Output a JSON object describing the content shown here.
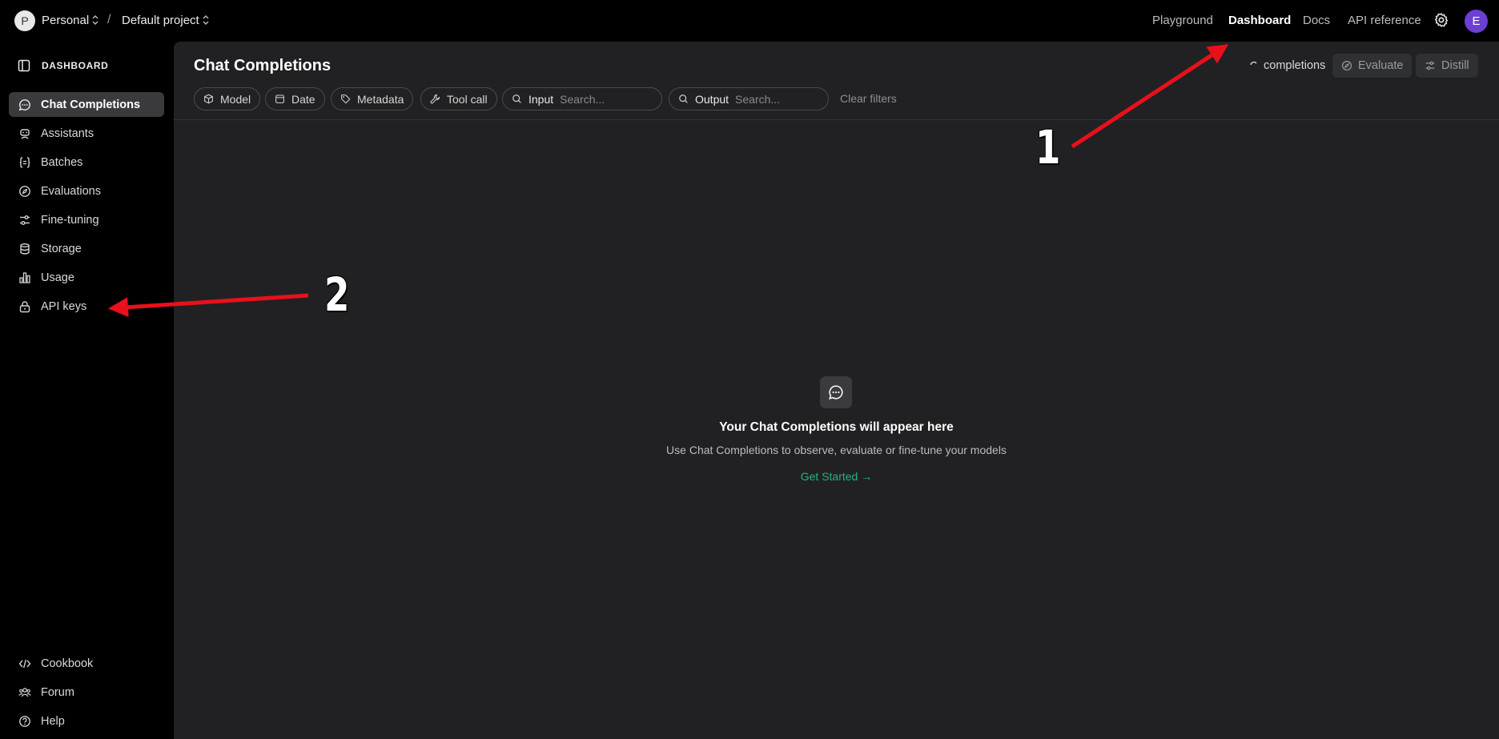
{
  "topbar": {
    "org_initial": "P",
    "org_name": "Personal",
    "separator": "/",
    "project_name": "Default project",
    "nav": [
      "Playground",
      "Dashboard",
      "Docs",
      "API reference"
    ],
    "active_nav": "Dashboard",
    "user_initial": "E"
  },
  "sidebar": {
    "header": "DASHBOARD",
    "items": [
      {
        "label": "Chat Completions",
        "icon": "chat-bubble-icon",
        "active": true
      },
      {
        "label": "Assistants",
        "icon": "robot-icon",
        "active": false
      },
      {
        "label": "Batches",
        "icon": "braces-icon",
        "active": false
      },
      {
        "label": "Evaluations",
        "icon": "compass-icon",
        "active": false
      },
      {
        "label": "Fine-tuning",
        "icon": "sliders-icon",
        "active": false
      },
      {
        "label": "Storage",
        "icon": "database-icon",
        "active": false
      },
      {
        "label": "Usage",
        "icon": "bar-chart-icon",
        "active": false
      },
      {
        "label": "API keys",
        "icon": "lock-icon",
        "active": false
      }
    ],
    "footer": [
      {
        "label": "Cookbook",
        "icon": "code-icon"
      },
      {
        "label": "Forum",
        "icon": "people-icon"
      },
      {
        "label": "Help",
        "icon": "help-icon"
      }
    ]
  },
  "main": {
    "title": "Chat Completions",
    "status_text": "completions",
    "evaluate_label": "Evaluate",
    "distill_label": "Distill",
    "filters": {
      "model": "Model",
      "date": "Date",
      "metadata": "Metadata",
      "tool_call": "Tool call",
      "input_label": "Input",
      "input_placeholder": "Search...",
      "output_label": "Output",
      "output_placeholder": "Search...",
      "clear": "Clear filters"
    },
    "empty": {
      "title": "Your Chat Completions will appear here",
      "subtitle": "Use Chat Completions to observe, evaluate or fine-tune your models",
      "cta": "Get Started →"
    }
  },
  "annotations": [
    {
      "number": "1"
    },
    {
      "number": "2"
    }
  ],
  "colors": {
    "background": "#000000",
    "panel": "#212123",
    "accent_green": "#26b27f",
    "user_avatar": "#6b3fd4",
    "annotation_arrow": "#e8101a"
  }
}
